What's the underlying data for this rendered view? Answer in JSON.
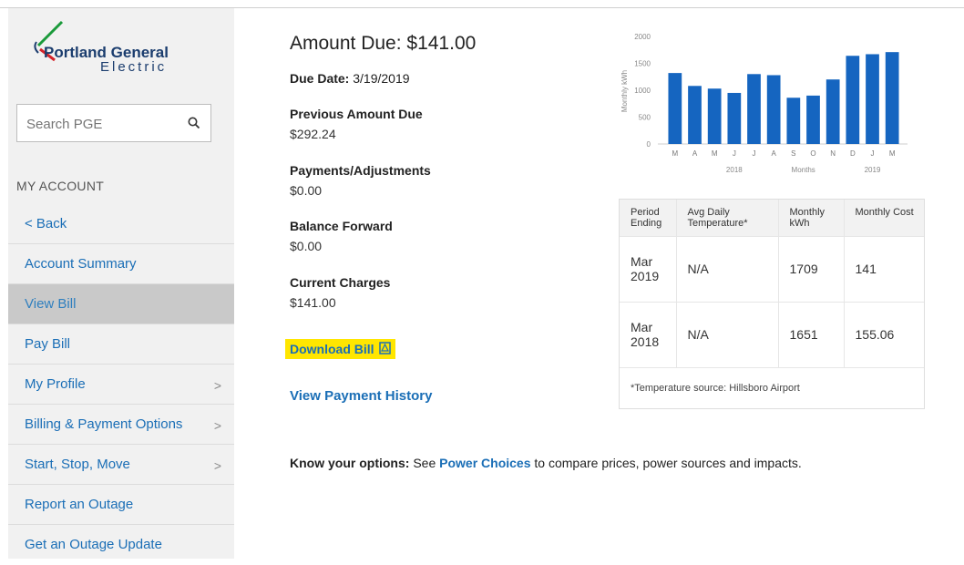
{
  "brand": {
    "line1": "Portland General",
    "line2": "Electric"
  },
  "search": {
    "placeholder": "Search PGE"
  },
  "sidebar": {
    "heading": "MY ACCOUNT",
    "items": [
      {
        "label": "< Back"
      },
      {
        "label": "Account Summary"
      },
      {
        "label": "View Bill"
      },
      {
        "label": "Pay Bill"
      },
      {
        "label": "My Profile",
        "chevron": ">"
      },
      {
        "label": "Billing & Payment Options",
        "chevron": ">"
      },
      {
        "label": "Start, Stop, Move",
        "chevron": ">"
      },
      {
        "label": "Report an Outage"
      },
      {
        "label": "Get an Outage Update"
      }
    ]
  },
  "bill": {
    "amount_due": "Amount Due: $141.00",
    "due_date_label": "Due Date:",
    "due_date": "3/19/2019",
    "lines": [
      {
        "title": "Previous Amount Due",
        "value": "$292.24"
      },
      {
        "title": "Payments/Adjustments",
        "value": "$0.00"
      },
      {
        "title": "Balance Forward",
        "value": "$0.00"
      },
      {
        "title": "Current Charges",
        "value": "$141.00"
      }
    ],
    "download_label": "Download Bill",
    "history_label": "View Payment History"
  },
  "options": {
    "lead": "Know your options:",
    "see": "See",
    "link": "Power Choices",
    "tail": "to compare prices, power sources and impacts."
  },
  "chart_data": {
    "type": "bar",
    "categories": [
      "M",
      "A",
      "M",
      "J",
      "J",
      "A",
      "S",
      "O",
      "N",
      "D",
      "J",
      "M"
    ],
    "values": [
      1320,
      1080,
      1030,
      950,
      1300,
      1280,
      860,
      900,
      1200,
      1640,
      1670,
      1709
    ],
    "ylabel": "Monthly kWh",
    "xlabel": "Months",
    "year_labels": [
      "2018",
      "2019"
    ],
    "ylim": [
      0,
      2000
    ],
    "yticks": [
      0,
      500,
      1000,
      1500,
      2000
    ],
    "bar_color": "#1565c0"
  },
  "usage_table": {
    "headers": [
      "Period Ending",
      "Avg Daily Temperature*",
      "Monthly kWh",
      "Monthly Cost"
    ],
    "rows": [
      [
        "Mar 2019",
        "N/A",
        "1709",
        "141"
      ],
      [
        "Mar 2018",
        "N/A",
        "1651",
        "155.06"
      ]
    ],
    "footnote": "*Temperature source: Hillsboro Airport"
  }
}
